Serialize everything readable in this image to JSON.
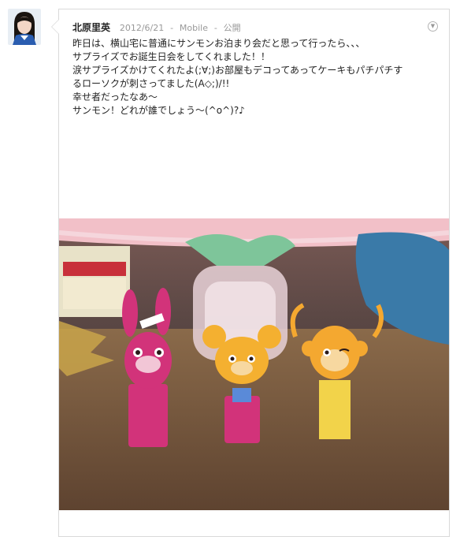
{
  "post": {
    "author": "北原里英",
    "date": "2012/6/21",
    "source": "Mobile",
    "visibility": "公開",
    "separator": "-",
    "lines": [
      "昨日は、横山宅に普通にサンモンお泊まり会だと思って行ったら、、、",
      "",
      "サプライズでお誕生日会をしてくれました！！",
      "",
      "涙サプライズかけてくれたよ(;∀;)お部屋もデコってあってケーキもパチパチす",
      "るローソクが刺さってました(A◇;)/!!",
      "",
      "幸せ者だったなあ〜",
      "",
      "",
      "",
      "サンモン！どれが誰でしょう〜(^o^)?♪"
    ]
  },
  "icons": {
    "menu": "chevron-down-icon"
  }
}
